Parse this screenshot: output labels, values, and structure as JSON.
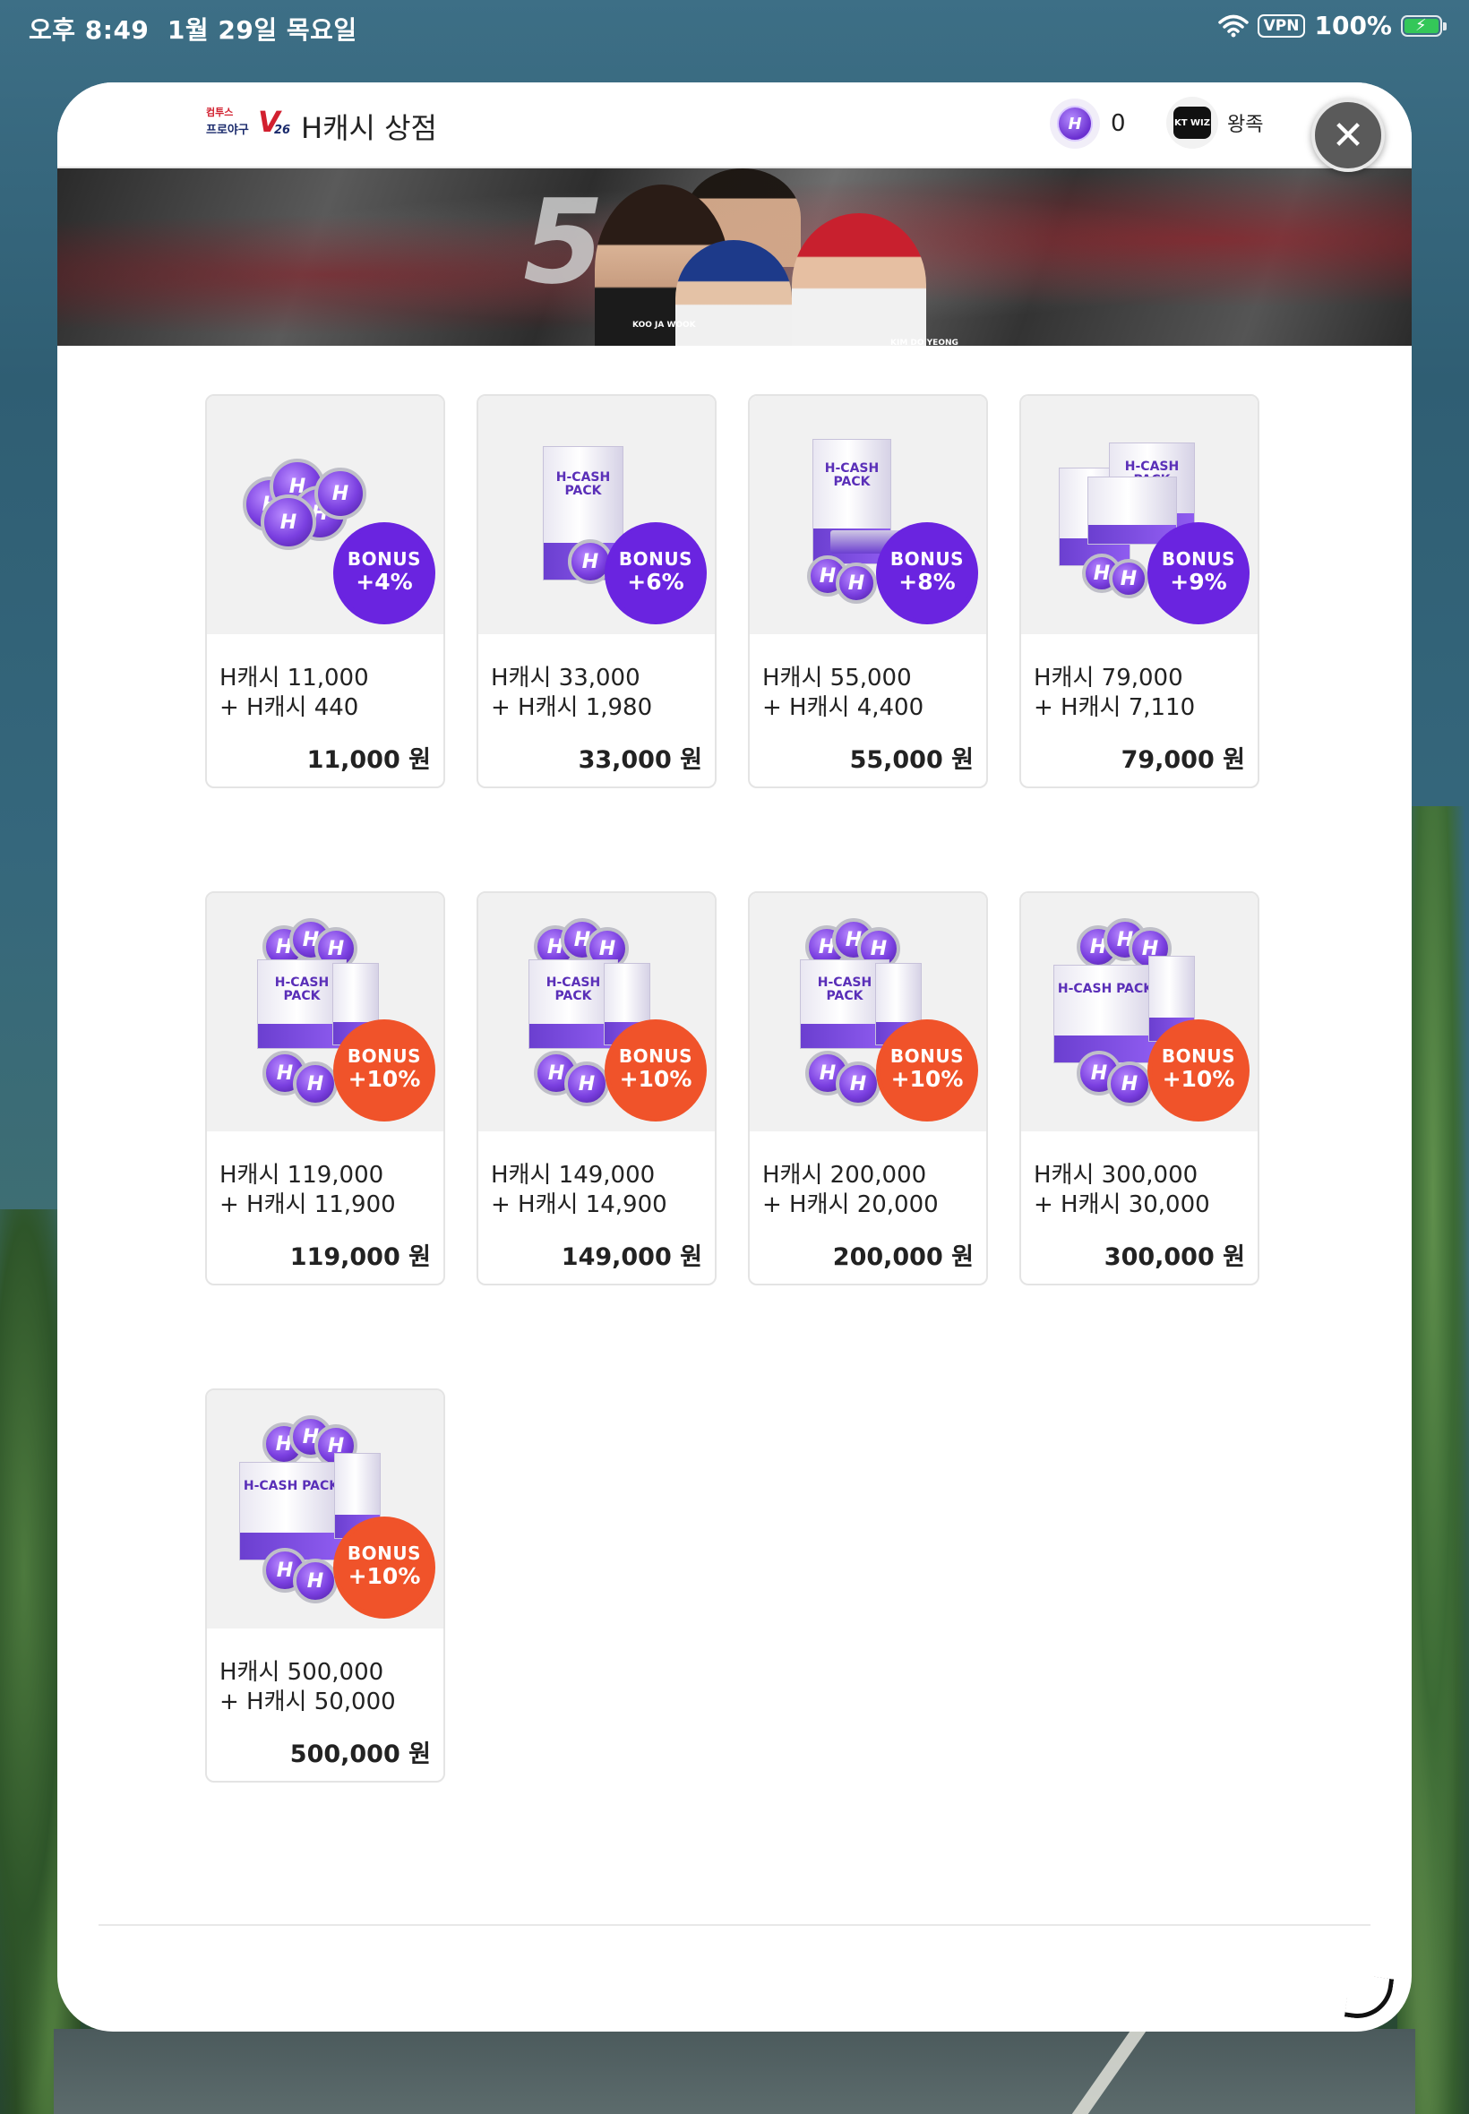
{
  "status_bar": {
    "time": "오후 8:49",
    "date": "1월 29일 목요일",
    "vpn": "VPN",
    "battery": "100%",
    "icons": [
      "wifi-icon",
      "vpn-icon",
      "battery-charging-icon"
    ]
  },
  "header": {
    "logo": {
      "top": "컴투스",
      "bottom": "프로야구",
      "mark": "V",
      "year": "26"
    },
    "title": "H캐시 상점",
    "currency_amount": "0",
    "team_name": "왕족",
    "team_emblem_text": "KT WIZ",
    "close_icon": "close-icon"
  },
  "banner": {
    "number": "5",
    "caption_left": "KOO JA WOOK",
    "caption_right": "KIM DO YEONG"
  },
  "colors": {
    "badge_purple": "#6a24e0",
    "badge_orange": "#f0532a",
    "coin_purple": "#7a3fe0"
  },
  "products": [
    {
      "badge_label": "BONUS",
      "bonus": "+4%",
      "badge_color": "purple",
      "art": "coins",
      "line1": "H캐시 11,000",
      "line2": "+ H캐시 440",
      "price": "11,000 원"
    },
    {
      "badge_label": "BONUS",
      "bonus": "+6%",
      "badge_color": "purple",
      "art": "box-small",
      "box_label": "H-CASH PACK",
      "line1": "H캐시 33,000",
      "line2": "+ H캐시 1,980",
      "price": "33,000 원"
    },
    {
      "badge_label": "BONUS",
      "bonus": "+8%",
      "badge_color": "purple",
      "art": "box-tray",
      "box_label": "H-CASH PACK",
      "line1": "H캐시 55,000",
      "line2": "+ H캐시 4,400",
      "price": "55,000 원"
    },
    {
      "badge_label": "BONUS",
      "bonus": "+9%",
      "badge_color": "purple",
      "art": "box-premium",
      "box_label": "H-CASH PACK",
      "line1": "H캐시 79,000",
      "line2": "+ H캐시 7,110",
      "price": "79,000 원"
    },
    {
      "badge_label": "BONUS",
      "bonus": "+10%",
      "badge_color": "orange",
      "art": "crate",
      "box_label": "H-CASH PACK",
      "line1": "H캐시 119,000",
      "line2": "+ H캐시 11,900",
      "price": "119,000 원"
    },
    {
      "badge_label": "BONUS",
      "bonus": "+10%",
      "badge_color": "orange",
      "art": "crate",
      "box_label": "H-CASH PACK",
      "line1": "H캐시 149,000",
      "line2": "+ H캐시 14,900",
      "price": "149,000 원"
    },
    {
      "badge_label": "BONUS",
      "bonus": "+10%",
      "badge_color": "orange",
      "art": "crate",
      "box_label": "H-CASH PACK",
      "line1": "H캐시 200,000",
      "line2": "+ H캐시 20,000",
      "price": "200,000 원"
    },
    {
      "badge_label": "BONUS",
      "bonus": "+10%",
      "badge_color": "orange",
      "art": "crate-large",
      "box_label": "H-CASH PACK",
      "line1": "H캐시 300,000",
      "line2": "+ H캐시 30,000",
      "price": "300,000 원"
    },
    {
      "badge_label": "BONUS",
      "bonus": "+10%",
      "badge_color": "orange",
      "art": "crate-large",
      "box_label": "H-CASH PACK",
      "line1": "H캐시 500,000",
      "line2": "+ H캐시 50,000",
      "price": "500,000 원"
    }
  ]
}
